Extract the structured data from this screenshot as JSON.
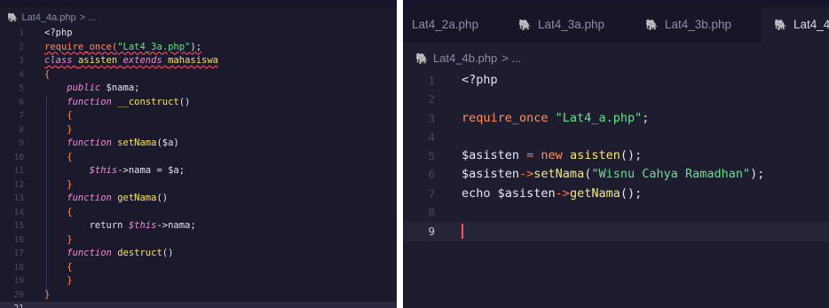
{
  "left_editor": {
    "breadcrumb": {
      "file": "Lat4_4a.php",
      "tail": "> ..."
    },
    "lines": [
      {
        "n": "1",
        "tokens": [
          {
            "t": "<?php",
            "c": "plain"
          }
        ]
      },
      {
        "n": "2",
        "tokens": [
          {
            "t": "require_once(",
            "c": "kw"
          },
          {
            "t": "\"Lat4_3a.php\"",
            "c": "str"
          },
          {
            "t": ");",
            "c": "plain"
          }
        ],
        "squiggle": true
      },
      {
        "n": "3",
        "tokens": [
          {
            "t": "class ",
            "c": "kwi"
          },
          {
            "t": "asisten ",
            "c": "cls"
          },
          {
            "t": "extends ",
            "c": "kwi"
          },
          {
            "t": "mahasiswa",
            "c": "cls"
          }
        ],
        "squiggle": true
      },
      {
        "n": "4",
        "tokens": [
          {
            "t": "{",
            "c": "brace"
          }
        ]
      },
      {
        "n": "5",
        "tokens": [
          {
            "t": "    public ",
            "c": "kwi"
          },
          {
            "t": "$nama;",
            "c": "var"
          }
        ]
      },
      {
        "n": "6",
        "tokens": [
          {
            "t": "    function ",
            "c": "kwi"
          },
          {
            "t": "__construct",
            "c": "fn"
          },
          {
            "t": "()",
            "c": "plain"
          }
        ]
      },
      {
        "n": "7",
        "tokens": [
          {
            "t": "    {",
            "c": "brace"
          }
        ]
      },
      {
        "n": "8",
        "tokens": [
          {
            "t": "    }",
            "c": "brace"
          }
        ]
      },
      {
        "n": "9",
        "tokens": [
          {
            "t": "    function ",
            "c": "kwi"
          },
          {
            "t": "setNama",
            "c": "fn"
          },
          {
            "t": "($a)",
            "c": "plain"
          }
        ]
      },
      {
        "n": "10",
        "tokens": [
          {
            "t": "    {",
            "c": "brace"
          }
        ]
      },
      {
        "n": "11",
        "tokens": [
          {
            "t": "        ",
            "c": "plain"
          },
          {
            "t": "$this",
            "c": "this"
          },
          {
            "t": "->nama = $a;",
            "c": "plain"
          }
        ]
      },
      {
        "n": "12",
        "tokens": [
          {
            "t": "    }",
            "c": "brace"
          }
        ]
      },
      {
        "n": "13",
        "tokens": [
          {
            "t": "    function ",
            "c": "kwi"
          },
          {
            "t": "getNama",
            "c": "fn"
          },
          {
            "t": "()",
            "c": "plain"
          }
        ]
      },
      {
        "n": "14",
        "tokens": [
          {
            "t": "    {",
            "c": "brace"
          }
        ]
      },
      {
        "n": "15",
        "tokens": [
          {
            "t": "        return ",
            "c": "plain"
          },
          {
            "t": "$this",
            "c": "this"
          },
          {
            "t": "->nama;",
            "c": "plain"
          }
        ]
      },
      {
        "n": "16",
        "tokens": [
          {
            "t": "    }",
            "c": "brace"
          }
        ]
      },
      {
        "n": "17",
        "tokens": [
          {
            "t": "    function ",
            "c": "kwi"
          },
          {
            "t": "destruct",
            "c": "fn"
          },
          {
            "t": "()",
            "c": "plain"
          }
        ]
      },
      {
        "n": "18",
        "tokens": [
          {
            "t": "    {",
            "c": "brace"
          }
        ]
      },
      {
        "n": "19",
        "tokens": [
          {
            "t": "    }",
            "c": "brace"
          }
        ]
      },
      {
        "n": "20",
        "tokens": [
          {
            "t": "}",
            "c": "brace"
          }
        ]
      },
      {
        "n": "21",
        "tokens": [],
        "active": true
      }
    ]
  },
  "right_editor": {
    "tabs": [
      {
        "label": "Lat4_2a.php",
        "icon": false
      },
      {
        "label": "Lat4_3a.php",
        "icon": true
      },
      {
        "label": "Lat4_3b.php",
        "icon": true
      },
      {
        "label": "Lat4_4",
        "icon": true,
        "active": true
      }
    ],
    "breadcrumb": {
      "file": "Lat4_4b.php",
      "tail": "> ..."
    },
    "lines": [
      {
        "n": "1",
        "tokens": [
          {
            "t": "<?php",
            "c": "plain"
          }
        ]
      },
      {
        "n": "2",
        "tokens": []
      },
      {
        "n": "3",
        "tokens": [
          {
            "t": "require_once ",
            "c": "kw"
          },
          {
            "t": "\"Lat4_a.php\"",
            "c": "str"
          },
          {
            "t": ";",
            "c": "plain"
          }
        ]
      },
      {
        "n": "4",
        "tokens": []
      },
      {
        "n": "5",
        "tokens": [
          {
            "t": "$asisten ",
            "c": "var"
          },
          {
            "t": "= ",
            "c": "op"
          },
          {
            "t": "new ",
            "c": "kw"
          },
          {
            "t": "asisten",
            "c": "fnb"
          },
          {
            "t": "();",
            "c": "plain"
          }
        ]
      },
      {
        "n": "6",
        "tokens": [
          {
            "t": "$asisten",
            "c": "var"
          },
          {
            "t": "->",
            "c": "op"
          },
          {
            "t": "setNama",
            "c": "fnb"
          },
          {
            "t": "(",
            "c": "plain"
          },
          {
            "t": "\"Wisnu Cahya Ramadhan\"",
            "c": "str"
          },
          {
            "t": ");",
            "c": "plain"
          }
        ]
      },
      {
        "n": "7",
        "tokens": [
          {
            "t": "echo ",
            "c": "plain"
          },
          {
            "t": "$asisten",
            "c": "var"
          },
          {
            "t": "->",
            "c": "op"
          },
          {
            "t": "getNama",
            "c": "fnb"
          },
          {
            "t": "();",
            "c": "plain"
          }
        ]
      },
      {
        "n": "8",
        "tokens": []
      },
      {
        "n": "9",
        "tokens": [],
        "active": true,
        "cursor": true
      }
    ]
  },
  "colors": {
    "editor_bg": "#1e1d30",
    "keyword": "#ff8f5e",
    "string": "#67e08a",
    "function": "#f7e26b",
    "php_icon": "#c16dd6",
    "cursor": "#ff4f63"
  },
  "icons": {
    "php_file": "php-file-icon",
    "breadcrumb_sep": "chevron-right"
  }
}
